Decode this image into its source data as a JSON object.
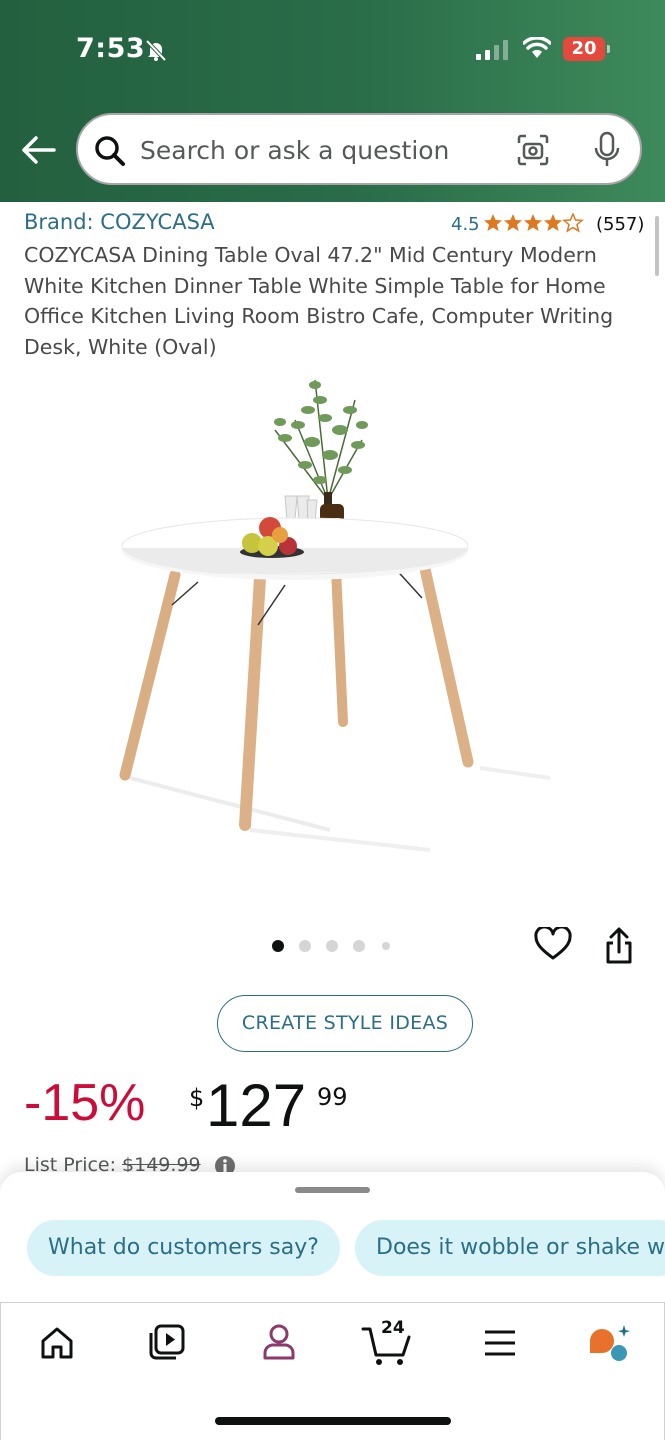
{
  "status_bar": {
    "time": "7:53",
    "battery": "20"
  },
  "search": {
    "placeholder": "Search or ask a question"
  },
  "product": {
    "brand": "Brand: COZYCASA",
    "rating": "4.5",
    "review_count": "(557)",
    "title": "COZYCASA Dining Table Oval 47.2\" Mid Century Modern White Kitchen Dinner Table White Simple Table for Home Office Kitchen Living Room Bistro Cafe, Computer Writing Desk, White (Oval)",
    "image_count": 5,
    "active_image": 1
  },
  "actions": {
    "style_button": "CREATE STYLE IDEAS"
  },
  "price": {
    "discount": "-15%",
    "currency": "$",
    "whole": "127",
    "cents": "99",
    "list_label": "List Price: ",
    "list_value": "$149.99"
  },
  "suggestions": [
    "What do customers say?",
    "Does it wobble or shake w"
  ],
  "tabbar": {
    "cart_count": "24"
  },
  "colors": {
    "accent": "#2b6e85",
    "discount": "#cc0c39",
    "header": "#23603f",
    "chip_bg": "#d8f3f7"
  },
  "icons": [
    "bell-slash-icon",
    "back-arrow-icon",
    "search-icon",
    "camera-icon",
    "mic-icon",
    "heart-icon",
    "share-icon",
    "info-icon",
    "home-icon",
    "video-icon",
    "profile-icon",
    "cart-icon",
    "menu-icon",
    "assistant-icon"
  ]
}
